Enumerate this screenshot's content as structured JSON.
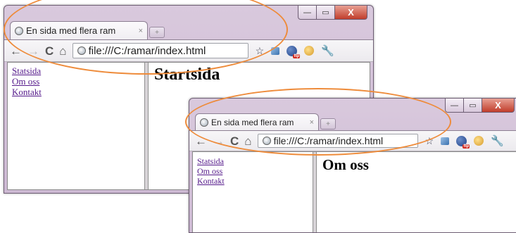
{
  "windows": [
    {
      "tab_title": "En sida med flera ram",
      "tab_close": "×",
      "url": "file:///C:/ramar/index.html",
      "nav_links": [
        "Statsida",
        "Om oss",
        "Kontakt"
      ],
      "heading": "Startsida"
    },
    {
      "tab_title": "En sida med flera ram",
      "tab_close": "×",
      "url": "file:///C:/ramar/index.html",
      "nav_links": [
        "Statsida",
        "Om oss",
        "Kontakt"
      ],
      "heading": "Om oss"
    }
  ],
  "caption_buttons": {
    "minimize": "—",
    "maximize": "▭",
    "close": "X"
  },
  "toolbar": {
    "back": "←",
    "forward": "→",
    "reload": "C",
    "home": "⌂",
    "star": "☆",
    "wrench": "🔧"
  },
  "icons": [
    "globe-icon",
    "back-icon",
    "forward-icon",
    "reload-icon",
    "home-icon",
    "star-icon",
    "wrench-icon"
  ],
  "colors": {
    "frame": "#cdb9d3",
    "link_visited": "#551a8b",
    "highlight": "#ee8b3a",
    "close_button": "#c13d2b"
  }
}
